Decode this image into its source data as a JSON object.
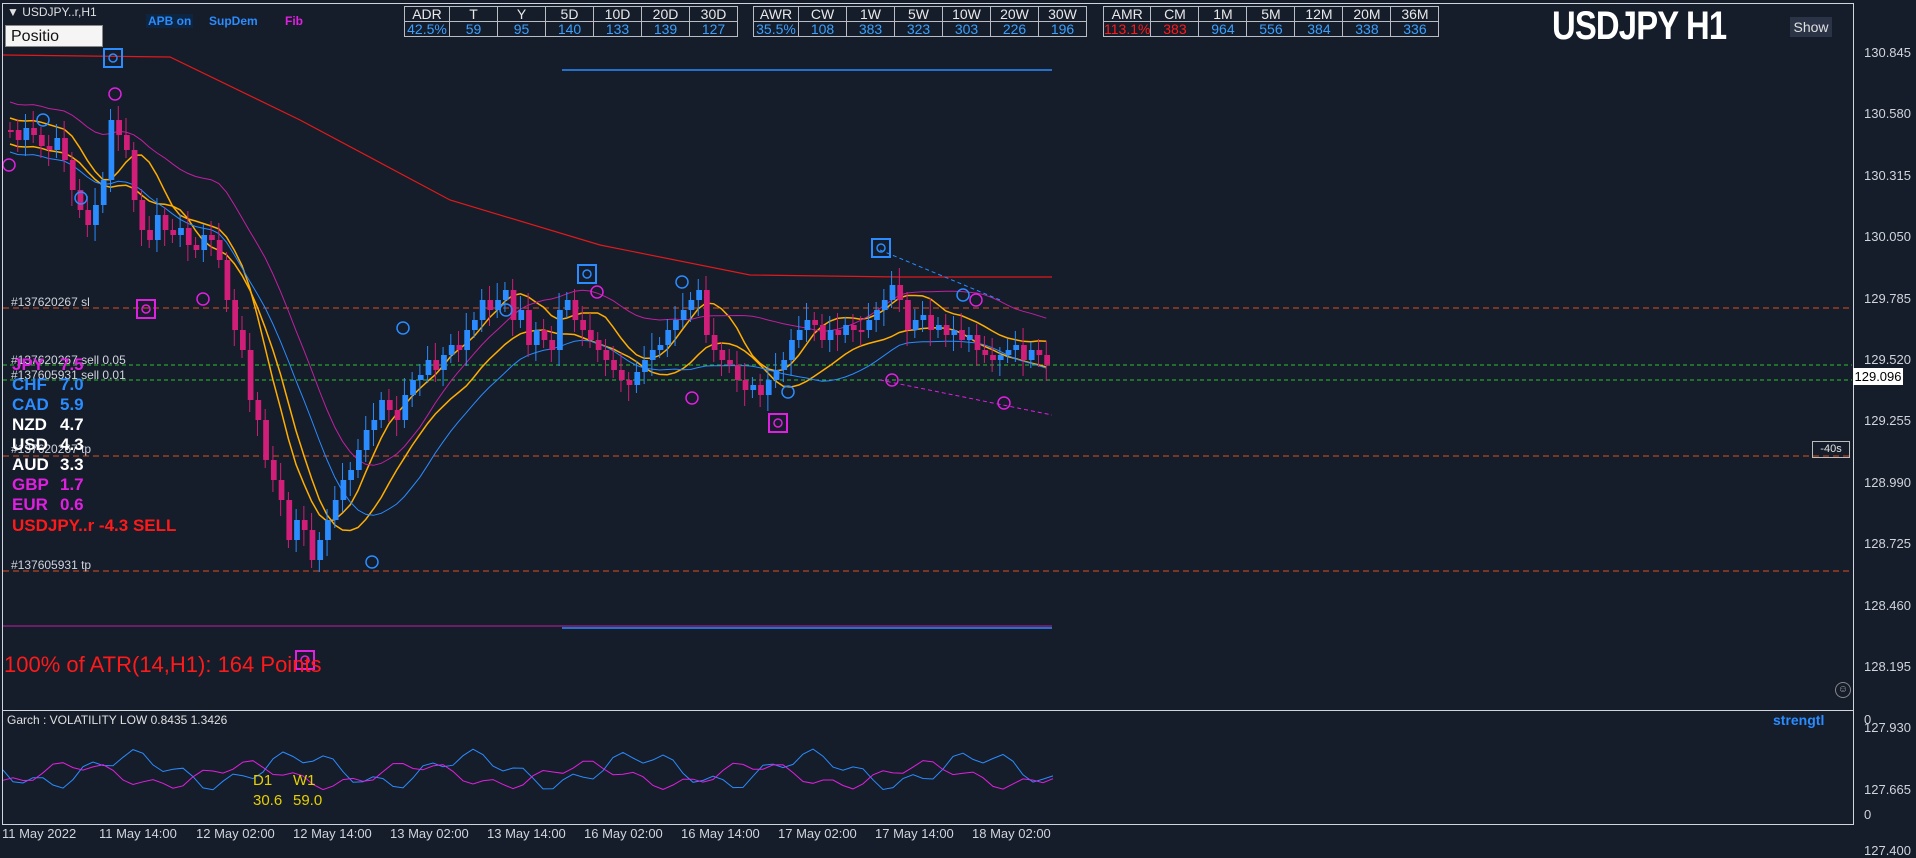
{
  "header": {
    "symbol": "USDJPY..r,H1",
    "position_box": "Positio",
    "apb": "APB on",
    "supdem": "SupDem",
    "fib": "Fib",
    "title": "USDJPY H1",
    "show": "Show"
  },
  "colors": {
    "bg": "#151c2a",
    "bull": "#2a8cff",
    "bear": "#d11e78",
    "ema": "#ffae00",
    "ma_long": "#e01a1a",
    "magenta": "#e020e0"
  },
  "tables": [
    {
      "headers": [
        "ADR",
        "T",
        "Y",
        "5D",
        "10D",
        "20D",
        "30D"
      ],
      "values": [
        "42.5%",
        "59",
        "95",
        "140",
        "133",
        "139",
        "127"
      ]
    },
    {
      "headers": [
        "AWR",
        "CW",
        "1W",
        "5W",
        "10W",
        "20W",
        "30W"
      ],
      "values": [
        "35.5%",
        "108",
        "383",
        "323",
        "303",
        "226",
        "196"
      ]
    },
    {
      "headers": [
        "AMR",
        "CM",
        "1M",
        "5M",
        "12M",
        "20M",
        "36M"
      ],
      "values": [
        "113.1%",
        "383",
        "964",
        "556",
        "384",
        "338",
        "336"
      ]
    }
  ],
  "price_axis": [
    "130.845",
    "130.580",
    "130.315",
    "130.050",
    "129.785",
    "129.520",
    "129.255",
    "128.990",
    "128.725",
    "128.460",
    "128.195",
    "127.930",
    "127.665",
    "127.400"
  ],
  "current_price": "129.096",
  "timer": "-40s",
  "time_axis": [
    "11 May 2022",
    "11 May 14:00",
    "12 May 02:00",
    "12 May 14:00",
    "13 May 02:00",
    "13 May 14:00",
    "16 May 02:00",
    "16 May 14:00",
    "17 May 02:00",
    "17 May 14:00",
    "18 May 02:00"
  ],
  "levels": [
    {
      "text": "#137620267 sl"
    },
    {
      "text": "#137620267 sell 0.05"
    },
    {
      "text": "#137605931 sell 0.01"
    },
    {
      "text": "#137620267 tp"
    },
    {
      "text": "#137605931 tp"
    }
  ],
  "currencies": [
    {
      "name": "JPY",
      "value": "7.5",
      "color": "#e020e0"
    },
    {
      "name": "CHF",
      "value": "7.0",
      "color": "#2a8cff"
    },
    {
      "name": "CAD",
      "value": "5.9",
      "color": "#2a8cff"
    },
    {
      "name": "NZD",
      "value": "4.7",
      "color": "#ffffff"
    },
    {
      "name": "USD",
      "value": "4.3",
      "color": "#ffffff"
    },
    {
      "name": "AUD",
      "value": "3.3",
      "color": "#ffffff"
    },
    {
      "name": "GBP",
      "value": "1.7",
      "color": "#e020e0"
    },
    {
      "name": "EUR",
      "value": "0.6",
      "color": "#e020e0"
    }
  ],
  "signal": "USDJPY..r -4.3 SELL",
  "atr_text": "100% of ATR(14,H1): 164  Points",
  "sub": {
    "garch": "Garch : VOLATILITY LOW 0.8435 1.3426",
    "strength": "strengtl",
    "d1_label": "D1",
    "w1_label": "W1",
    "d1_value": "30.6",
    "w1_value": "59.0",
    "axis_top": "0",
    "axis_bottom": "0"
  }
}
